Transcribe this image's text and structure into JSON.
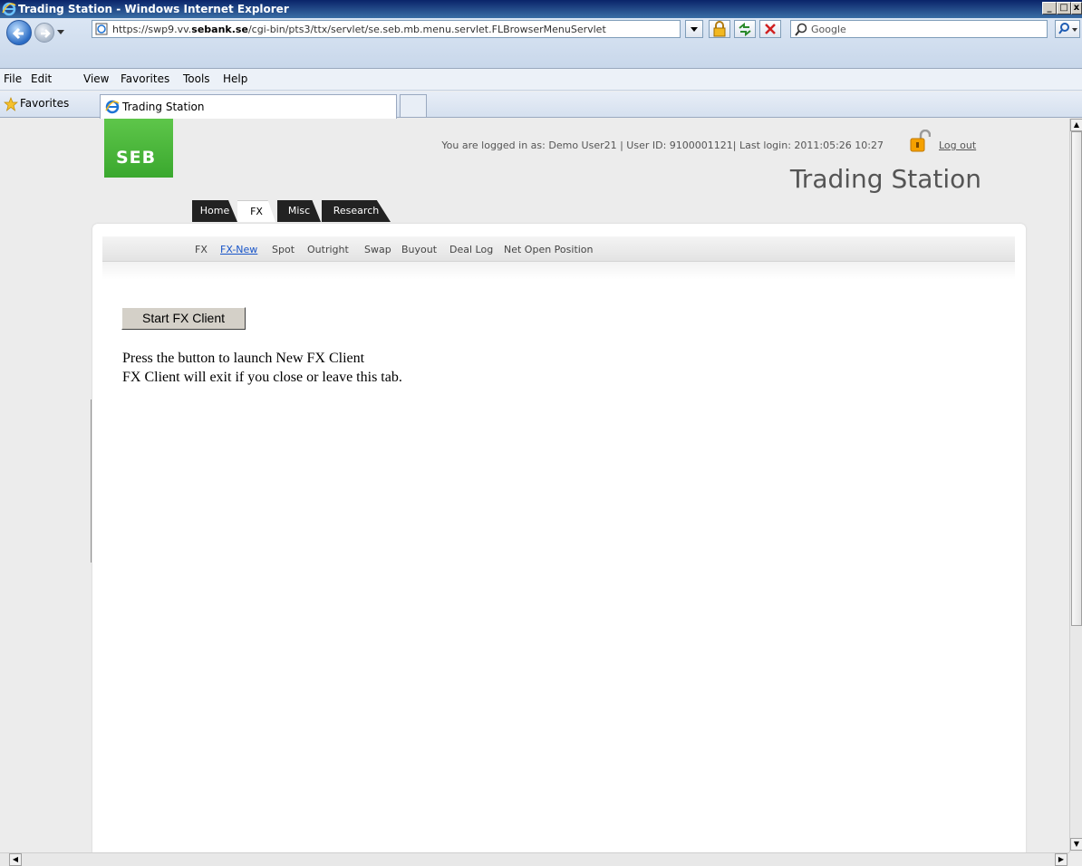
{
  "window": {
    "title": "Trading Station - Windows Internet Explorer",
    "min": "_",
    "max": "□",
    "close": "x"
  },
  "address": {
    "url_prefix": "https://swp9.vv.",
    "url_host": "sebank.se",
    "url_path": "/cgi-bin/pts3/ttx/servlet/se.seb.mb.menu.servlet.FLBrowserMenuServlet",
    "search_placeholder": "Google"
  },
  "menu": {
    "items": [
      "File",
      "Edit",
      "View",
      "Favorites",
      "Tools",
      "Help"
    ]
  },
  "favorites_bar": {
    "label": "Favorites",
    "tab_title": "Trading Station"
  },
  "page": {
    "logo": "SEB",
    "login_info": "You are logged in as: Demo User21 | User ID: 9100001121| Last login: 2011:05:26 10:27",
    "logout": "Log out",
    "brand_title": "Trading Station",
    "main_tabs": [
      {
        "label": "Home"
      },
      {
        "label": "FX"
      },
      {
        "label": "Misc"
      },
      {
        "label": "Research"
      }
    ],
    "sub_nav": [
      "FX",
      "FX-New",
      "Spot",
      "Outright",
      "Swap",
      "Buyout",
      "Deal Log",
      "Net Open Position"
    ],
    "start_button": "Start FX Client",
    "info_line_1": "Press the button to launch New FX Client",
    "info_line_2": "FX Client will exit if you close or leave this tab."
  },
  "colors": {
    "seb_green": "#3aa82e",
    "link_blue": "#1a56c9",
    "tab_dark": "#222222"
  }
}
